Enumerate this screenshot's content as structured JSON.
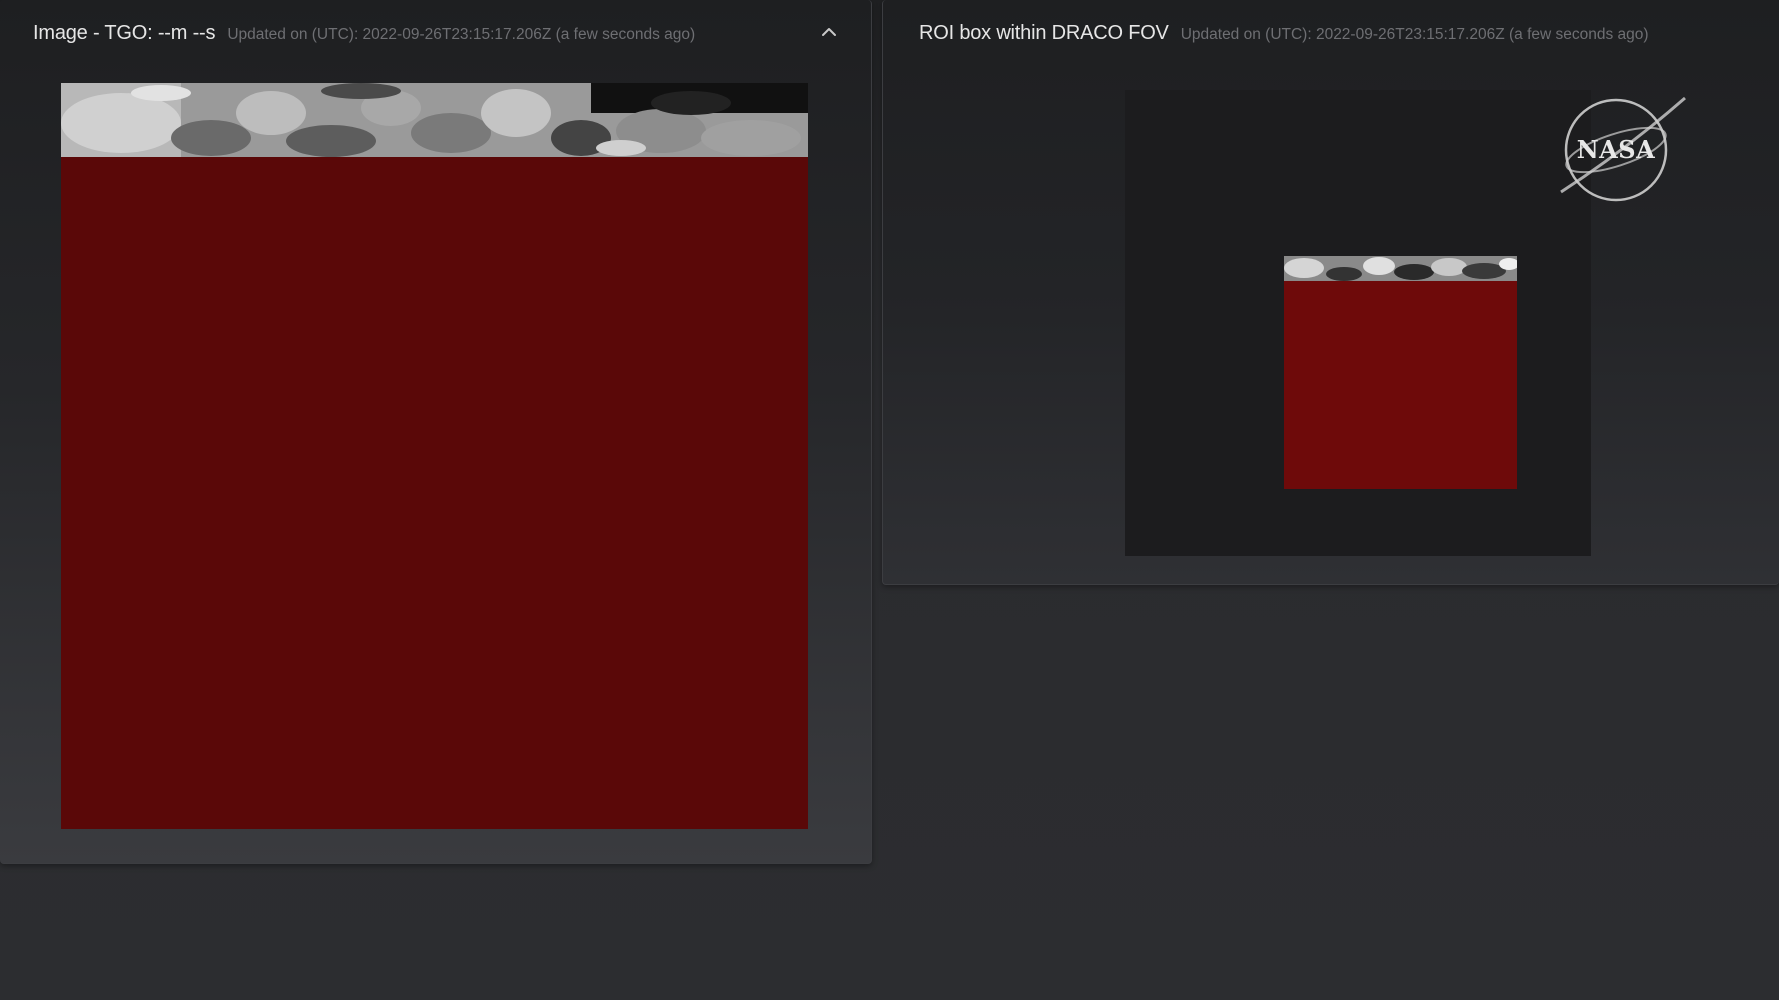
{
  "left_panel": {
    "title": "Image - TGO: --m --s",
    "updated": "Updated on (UTC): 2022-09-26T23:15:17.206Z (a few seconds ago)",
    "collapse_icon": "chevron-up-icon"
  },
  "right_panel": {
    "title": "ROI box within DRACO FOV",
    "updated": "Updated on (UTC): 2022-09-26T23:15:17.206Z (a few seconds ago)"
  },
  "logo": {
    "text": "NASA",
    "icon": "nasa-meatball-icon"
  },
  "colors": {
    "image_red": "#5a0808",
    "roi_red": "#6e0a0a",
    "fov_background": "#1c1c1e",
    "panel_border": "#3c3d41"
  }
}
